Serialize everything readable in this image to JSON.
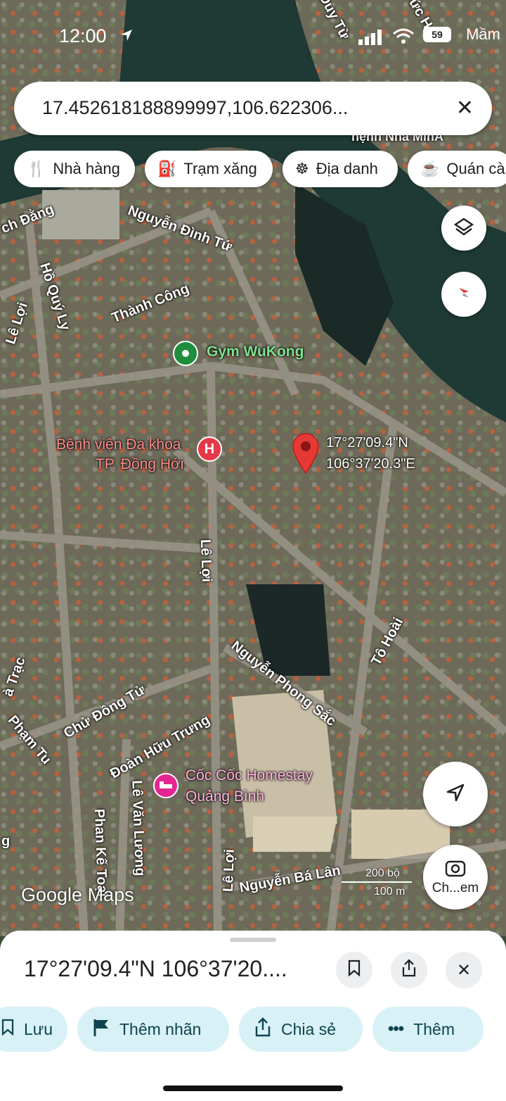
{
  "status_bar": {
    "time": "12:00",
    "battery": "59",
    "carrier": "Mầm"
  },
  "search": {
    "query": "17.452618188899997,106.622306..."
  },
  "chips": [
    {
      "label": "Nhà hàng",
      "icon": "restaurant-icon"
    },
    {
      "label": "Trạm xăng",
      "icon": "gas-station-icon"
    },
    {
      "label": "Địa danh",
      "icon": "landmark-icon"
    },
    {
      "label": "Quán cà",
      "icon": "coffee-icon"
    }
  ],
  "map": {
    "streets": {
      "duy_tu": "Duy Từ",
      "duc_h": "ức H",
      "ch_dang": "ch Đằng",
      "nguyen_dinh_tu": "Nguyễn Đình Tứ",
      "ho_quy_ly": "Hồ Quý Ly",
      "thanh_cong": "Thành Công",
      "le_loi_top": "Lê Lợi",
      "le_loi_mid": "Lê Lợi",
      "le_loi_bottom": "Lê Lợi",
      "to_hoai": "Tô Hoài",
      "nguyen_phong_sac": "Nguyễn Phong Sắc",
      "ha_trac": "à Trạc",
      "chu_dong_tu": "Chử Đồng Tử",
      "pham_tu": "Phạm Tu",
      "doan_huu_trung": "Đoàn Hữu Trưng",
      "le_van_luong": "Lê Văn Lương",
      "phan_ke_toai": "Phan Kế Toại",
      "nguyen_ba_lan": "Nguyễn Bá Lân",
      "g": "g"
    },
    "pois": {
      "gym": "Gym WuKong",
      "hospital_line1": "Bệnh viện Đa khoa",
      "hospital_line2": "TP. Đồng Hới",
      "homestay_line1": "Cốc Cốc Homestay",
      "homestay_line2": "Quảng Bình",
      "top_poi": "hệnh Nha MinA"
    },
    "pin": {
      "lat": "17°27'09.4\"N",
      "lng": "106°37'20.3\"E"
    },
    "scale": {
      "top": "200 bộ",
      "bottom": "100 m"
    },
    "watermark": "Google Maps",
    "lens_label": "Ch...em"
  },
  "sheet": {
    "title": "17°27'09.4\"N 106°37'20....",
    "actions": [
      {
        "label": "Lưu"
      },
      {
        "label": "Thêm nhãn"
      },
      {
        "label": "Chia sẻ"
      },
      {
        "label": "Thêm"
      }
    ]
  },
  "colors": {
    "pin": "#e53935",
    "action_bg": "#d8f1f6",
    "gym": "#1e8e3e",
    "hospital": "#e53949",
    "homestay": "#e52592"
  }
}
